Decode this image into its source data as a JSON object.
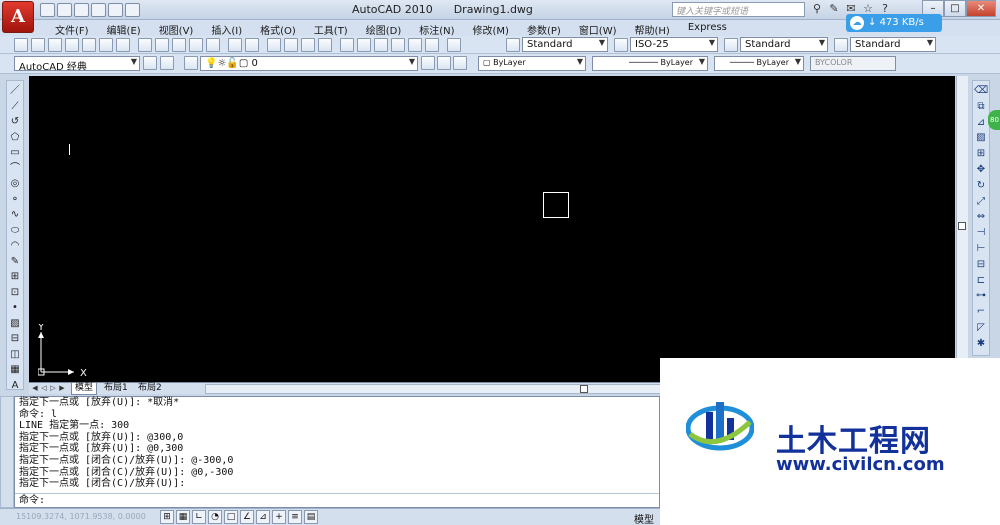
{
  "titlebar": {
    "app": "AutoCAD 2010",
    "doc": "Drawing1.dwg",
    "search_placeholder": "键入关键字或短语",
    "speed": "473 KB/s"
  },
  "menu": [
    "文件(F)",
    "编辑(E)",
    "视图(V)",
    "插入(I)",
    "格式(O)",
    "工具(T)",
    "绘图(D)",
    "标注(N)",
    "修改(M)",
    "参数(P)",
    "窗口(W)",
    "帮助(H)",
    "Express"
  ],
  "toolbar": {
    "text_style": "Standard",
    "dim_style": "ISO-25",
    "table_style": "Standard",
    "mleader_style": "Standard",
    "workspace": "AutoCAD 经典",
    "layer": "0",
    "color": "ByLayer",
    "linetype": "ByLayer",
    "lineweight": "ByLayer",
    "plotstyle": "BYCOLOR"
  },
  "tabs": [
    "模型",
    "布局1",
    "布局2"
  ],
  "ucs": {
    "x": "X",
    "y": "Y"
  },
  "command_history": [
    "指定下一点或 [放弃(U)]: *取消*",
    "命令: l",
    "LINE 指定第一点: 300",
    "指定下一点或 [放弃(U)]: @300,0",
    "指定下一点或 [放弃(U)]: @0,300",
    "指定下一点或 [闭合(C)/放弃(U)]: @-300,0",
    "指定下一点或 [闭合(C)/放弃(U)]: @0,-300",
    "指定下一点或 [闭合(C)/放弃(U)]:"
  ],
  "command_prompt": "命令:",
  "status": {
    "coords": "15109.3274, 1071.9538, 0.0000",
    "model": "模型"
  },
  "watermark": {
    "title": "土木工程网",
    "url": "www.civilcn.com"
  }
}
